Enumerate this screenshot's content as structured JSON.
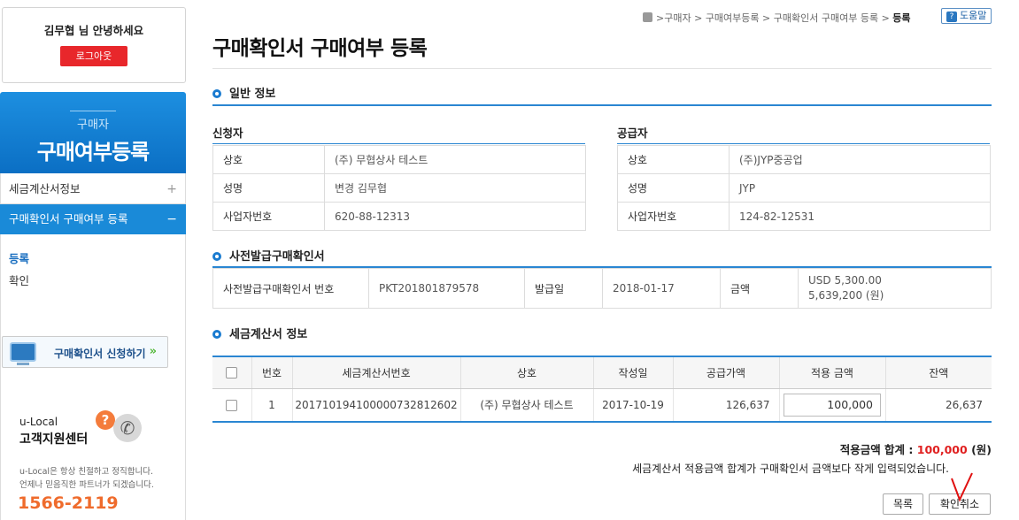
{
  "sidebar": {
    "greeting": "김무협 님 안녕하세요",
    "logout": "로그아웃",
    "banner_sub": "구매자",
    "banner_main": "구매여부등록",
    "menu": [
      {
        "label": "세금계산서정보",
        "sign": "+"
      },
      {
        "label": "구매확인서 구매여부 등록",
        "sign": "−"
      }
    ],
    "submenu": [
      "등록",
      "확인"
    ],
    "apply_banner": "구매확인서 신청하기",
    "support_brand": "u-Local",
    "support_title": "고객지원센터",
    "support_desc1": "u-Local은 항상 친절하고 정직합니다.",
    "support_desc2": "언제나 믿음직한 파트너가 되겠습니다.",
    "support_phone": "1566-2119"
  },
  "breadcrumb": {
    "items": [
      "구매자",
      "구매여부등록",
      "구매확인서 구매여부 등록"
    ],
    "current": "등록",
    "help": "도움말"
  },
  "page_title": "구매확인서 구매여부 등록",
  "general": {
    "title": "일반 정보",
    "applicant": {
      "title": "신청자",
      "rows": [
        {
          "label": "상호",
          "value": "(주) 무협상사 테스트"
        },
        {
          "label": "성명",
          "value": "변경 김무협"
        },
        {
          "label": "사업자번호",
          "value": "620-88-12313"
        }
      ]
    },
    "supplier": {
      "title": "공급자",
      "rows": [
        {
          "label": "상호",
          "value": "(주)JYP중공업"
        },
        {
          "label": "성명",
          "value": "JYP"
        },
        {
          "label": "사업자번호",
          "value": "124-82-12531"
        }
      ]
    }
  },
  "prior": {
    "title": "사전발급구매확인서",
    "no_label": "사전발급구매확인서 번호",
    "no_value": "PKT201801879578",
    "date_label": "발급일",
    "date_value": "2018-01-17",
    "amount_label": "금액",
    "amount_usd": "USD 5,300.00",
    "amount_krw": "5,639,200 (원)"
  },
  "tax": {
    "title": "세금계산서 정보",
    "headers": [
      "번호",
      "세금계산서번호",
      "상호",
      "작성일",
      "공급가액",
      "적용 금액",
      "잔액"
    ],
    "rows": [
      {
        "no": "1",
        "invoice": "20171019410000073281260​2",
        "company": "(주) 무협상사 테스트",
        "date": "2017-10-19",
        "supply": "126,637",
        "applied": "100,000",
        "balance": "26,637"
      }
    ]
  },
  "total": {
    "label": "적용금액 합계 :",
    "amount": "100,000",
    "unit": "(원)"
  },
  "notice": "세금계산서 적용금액 합계가 구매확인서 금액보다 작게 입력되었습니다.",
  "buttons": {
    "list": "목록",
    "cancel": "확인취소"
  }
}
